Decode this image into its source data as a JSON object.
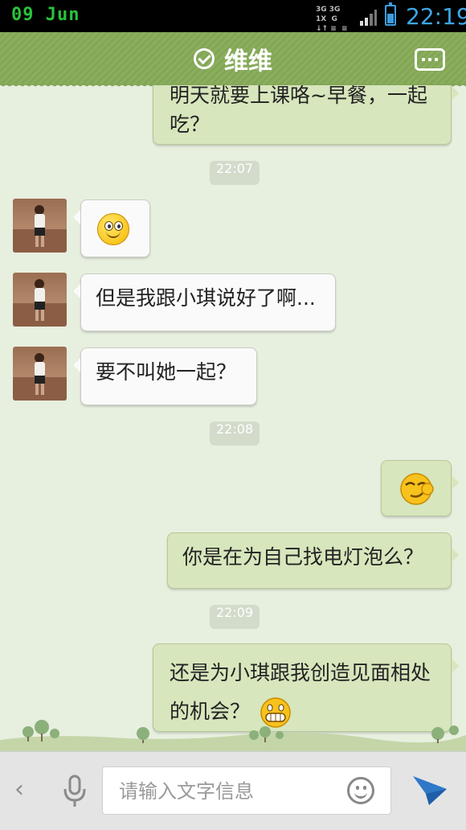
{
  "status_bar": {
    "date": "09 Jun",
    "network": "3G 3G 1X G",
    "time": "22:19",
    "battery_level": 0.6,
    "battery_color": "#3d9cdf",
    "date_color": "#29c33b"
  },
  "header": {
    "title": "维维",
    "status_icon": "check-circle-icon",
    "menu_icon": "ellipsis-icon",
    "background": "#86aa5b"
  },
  "messages": [
    {
      "side": "me",
      "type": "text",
      "text": "明天就要上课咯~早餐，一起吃？"
    },
    {
      "type": "time",
      "text": "22:07"
    },
    {
      "side": "them",
      "type": "emoji",
      "emoji": "smile-emoji-icon"
    },
    {
      "side": "them",
      "type": "text",
      "text": "但是我跟小琪说好了啊..."
    },
    {
      "side": "them",
      "type": "text",
      "text": "要不叫她一起？"
    },
    {
      "type": "time",
      "text": "22:08"
    },
    {
      "side": "me",
      "type": "emoji",
      "emoji": "smug-emoji-icon"
    },
    {
      "side": "me",
      "type": "text",
      "text": "你是在为自己找电灯泡么？"
    },
    {
      "type": "time",
      "text": "22:09"
    },
    {
      "side": "me",
      "type": "text",
      "text": "还是为小琪跟我创造见面相处的机会？",
      "emoji": "grin-emoji-icon"
    }
  ],
  "input_bar": {
    "placeholder": "请输入文字信息",
    "back_icon": "chevron-left-icon",
    "voice_icon": "microphone-icon",
    "emoji_icon": "smiley-face-icon",
    "send_icon": "send-paper-plane-icon",
    "send_color": "#2f78c8"
  }
}
